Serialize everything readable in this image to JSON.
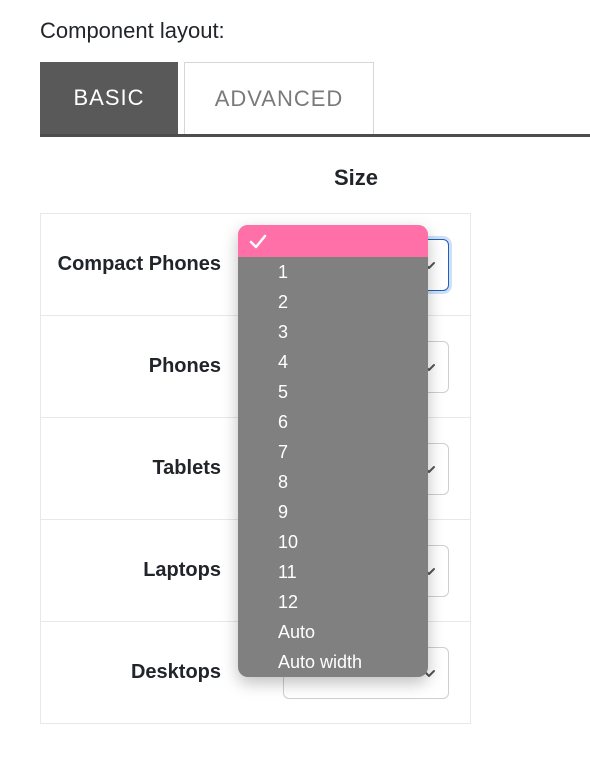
{
  "section_label": "Component layout:",
  "tabs": {
    "basic": "BASIC",
    "advanced": "ADVANCED"
  },
  "column_header": "Size",
  "rows": [
    {
      "label": "Compact Phones"
    },
    {
      "label": "Phones"
    },
    {
      "label": "Tablets"
    },
    {
      "label": "Laptops"
    },
    {
      "label": "Desktops"
    }
  ],
  "size_options": [
    "",
    "1",
    "2",
    "3",
    "4",
    "5",
    "6",
    "7",
    "8",
    "9",
    "10",
    "11",
    "12",
    "Auto",
    "Auto width"
  ],
  "selected_option_index": 0
}
